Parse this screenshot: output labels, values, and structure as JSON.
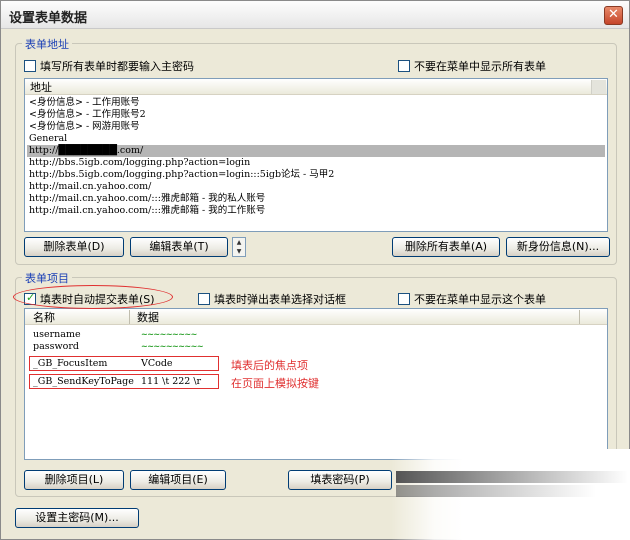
{
  "window": {
    "title": "设置表单数据",
    "close_glyph": "✕"
  },
  "form_address": {
    "legend": "表单地址",
    "check_require_password": "填写所有表单时都要输入主密码",
    "check_hide_all_menu": "不要在菜单中显示所有表单",
    "list_header": "地址",
    "rows": [
      "<身份信息> - 工作用账号",
      "<身份信息> - 工作用账号2",
      "<身份信息> - 网游用账号",
      "General",
      "http://████████.com/",
      "http://bbs.5igb.com/logging.php?action=login",
      "http://bbs.5igb.com/logging.php?action=login:::5igb论坛 - 马甲2",
      "http://mail.cn.yahoo.com/",
      "http://mail.cn.yahoo.com/:::雅虎邮箱 - 我的私人账号",
      "http://mail.cn.yahoo.com/:::雅虎邮箱 - 我的工作账号"
    ],
    "selected_row_index": 4,
    "btn_delete_form": "删除表单(D)",
    "btn_edit_form": "编辑表单(T)",
    "btn_delete_all": "删除所有表单(A)",
    "btn_new_identity": "新身份信息(N)..."
  },
  "form_items": {
    "legend": "表单项目",
    "check_auto_submit": "填表时自动提交表单(S)",
    "check_auto_submit_checked": true,
    "check_popup_dialog": "填表时弹出表单选择对话框",
    "check_hide_item_menu": "不要在菜单中显示这个表单",
    "col_name": "名称",
    "col_data": "数据",
    "rows": [
      {
        "name": "username",
        "value": "~~~~~~~~~"
      },
      {
        "name": "password",
        "value": "~~~~~~~~~~"
      },
      {
        "name": "_GB_FocusItem",
        "value": "VCode"
      },
      {
        "name": "_GB_SendKeyToPage",
        "value": "111 \\t 222 \\r"
      }
    ],
    "annotation_focus": "填表后的焦点项",
    "annotation_sendkey": "在页面上模拟按键",
    "btn_delete_item": "删除项目(L)",
    "btn_edit_item": "编辑项目(E)",
    "btn_fill_password": "填表密码(P)"
  },
  "bottom": {
    "btn_master_password": "设置主密码(M)..."
  },
  "colors": {
    "legend_blue": "#1a3fb5",
    "annotation_red": "#e03030",
    "selection_gray": "#b5b5b5"
  }
}
